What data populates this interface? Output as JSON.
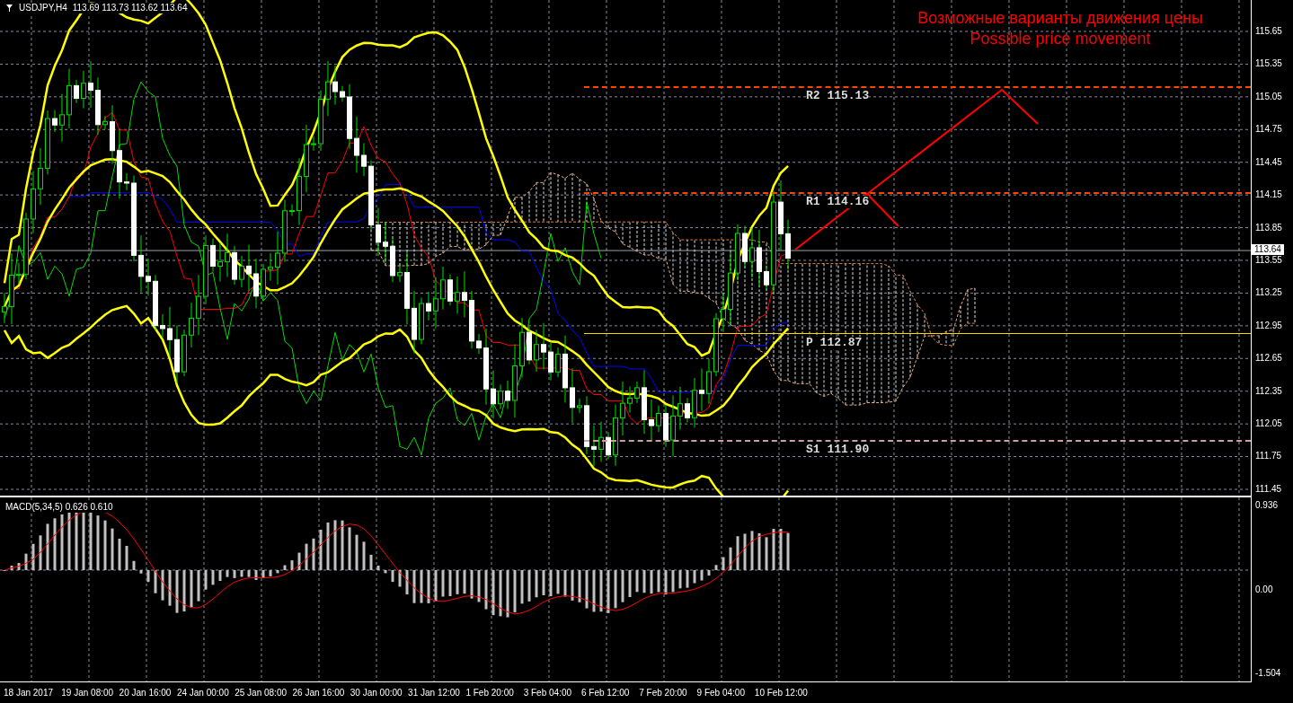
{
  "chart": {
    "symbol": "USDJPY,H4",
    "ohlc": "113.69 113.73 113.62 113.64",
    "forecast_title": [
      "Возможные варианты движения цены",
      "Possible price movement"
    ],
    "levels": [
      {
        "label": "R2 115.13",
        "color": "#ff4500",
        "kind": "dashed"
      },
      {
        "label": "R1 114.16",
        "color": "#ff4500",
        "kind": "dashed"
      },
      {
        "label": "P 112.87",
        "color": "#ffd700",
        "kind": "solid"
      },
      {
        "label": "S1 111.90",
        "color": "#c8a0a0",
        "kind": "dashed"
      }
    ],
    "price_axis": [
      "115.65",
      "115.35",
      "115.05",
      "114.75",
      "114.45",
      "114.15",
      "113.85",
      "113.55",
      "113.25",
      "112.95",
      "112.65",
      "112.35",
      "112.05",
      "111.75",
      "111.45"
    ],
    "current_price": "113.64"
  },
  "macd": {
    "label": "MACD(5,34,5) 0.626 0.610",
    "axis": [
      "0.936",
      "0.00",
      "-1.504"
    ]
  },
  "time_axis": [
    "18 Jan 2017",
    "19 Jan 08:00",
    "20 Jan 16:00",
    "24 Jan 00:00",
    "25 Jan 08:00",
    "26 Jan 16:00",
    "30 Jan 00:00",
    "31 Jan 12:00",
    "1 Feb 20:00",
    "3 Feb 04:00",
    "6 Feb 12:00",
    "7 Feb 20:00",
    "9 Feb 04:00",
    "10 Feb 12:00"
  ]
}
